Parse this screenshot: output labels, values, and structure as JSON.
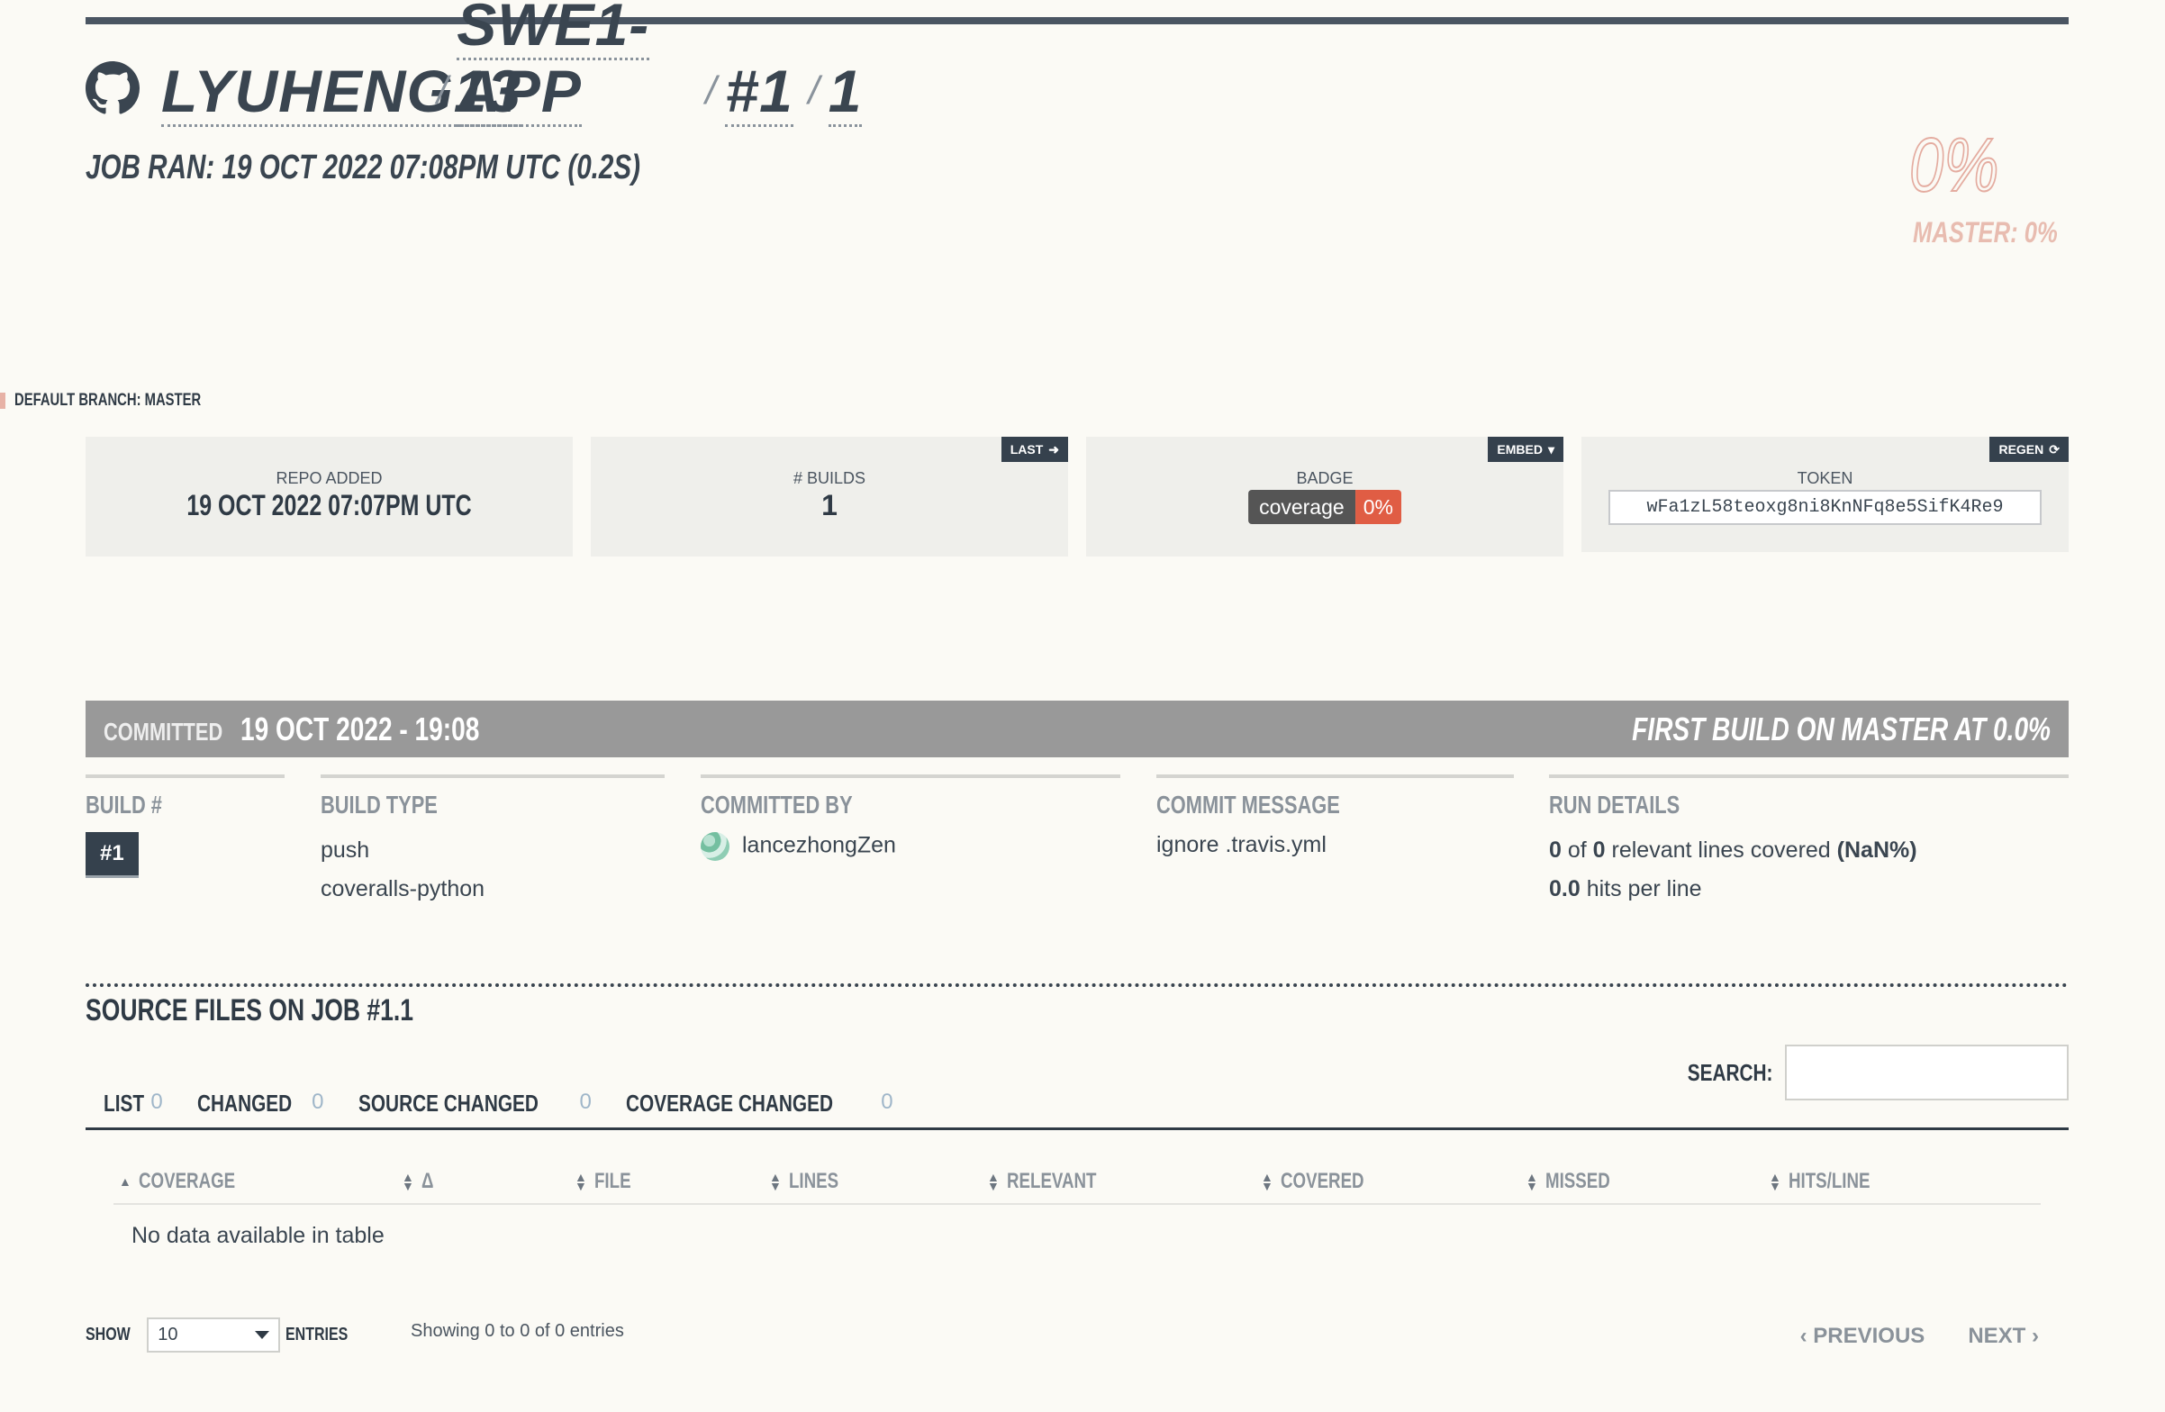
{
  "breadcrumb": {
    "owner": "LYUHENG13",
    "repo": "SWE1-APP",
    "build": "#1",
    "job": "1",
    "separator": "/"
  },
  "job_ran": "JOB RAN: 19 OCT 2022 07:08PM UTC (0.2S)",
  "coverage": {
    "percent": "0%",
    "master": "MASTER: 0%"
  },
  "default_branch": "DEFAULT BRANCH: MASTER",
  "cards": {
    "repo_added": {
      "label": "REPO ADDED",
      "value": "19 OCT 2022 07:07PM UTC"
    },
    "builds": {
      "label": "# BUILDS",
      "value": "1",
      "tag": "LAST"
    },
    "badge": {
      "label": "BADGE",
      "left": "coverage",
      "right": "0%",
      "tag": "EMBED"
    },
    "token": {
      "label": "TOKEN",
      "value": "wFa1zL58teoxg8ni8KnNFq8e5SifK4Re9",
      "tag": "REGEN"
    }
  },
  "commit_bar": {
    "label": "COMMITTED",
    "date": "19 OCT 2022 - 19:08",
    "summary": "FIRST BUILD ON MASTER AT 0.0%"
  },
  "details": {
    "build_heading": "BUILD #",
    "build_value": "#1",
    "type_heading": "BUILD TYPE",
    "type_lines": [
      "push",
      "coveralls-python"
    ],
    "committer_heading": "COMMITTED BY",
    "committer": "lancezhongZen",
    "message_heading": "COMMIT MESSAGE",
    "message": "ignore .travis.yml",
    "run_heading": "RUN DETAILS",
    "run_line1_a": "0",
    "run_line1_b": " of ",
    "run_line1_c": "0",
    "run_line1_d": " relevant lines covered ",
    "run_line1_e": "(NaN%)",
    "run_line2_a": "0.0",
    "run_line2_b": " hits per line"
  },
  "source_files": {
    "title": "SOURCE FILES ON JOB #1.1",
    "search_label": "SEARCH:",
    "tabs": [
      {
        "label": "LIST",
        "count": "0"
      },
      {
        "label": "CHANGED",
        "count": "0"
      },
      {
        "label": "SOURCE CHANGED",
        "count": "0"
      },
      {
        "label": "COVERAGE CHANGED",
        "count": "0"
      }
    ],
    "columns": [
      "COVERAGE",
      "Δ",
      "FILE",
      "LINES",
      "RELEVANT",
      "COVERED",
      "MISSED",
      "HITS/LINE"
    ],
    "empty": "No data available in table",
    "show_label": "SHOW",
    "entries_value": "10",
    "entries_label": "ENTRIES",
    "showing": "Showing 0 to 0 of 0 entries",
    "previous": "PREVIOUS",
    "next": "NEXT"
  }
}
